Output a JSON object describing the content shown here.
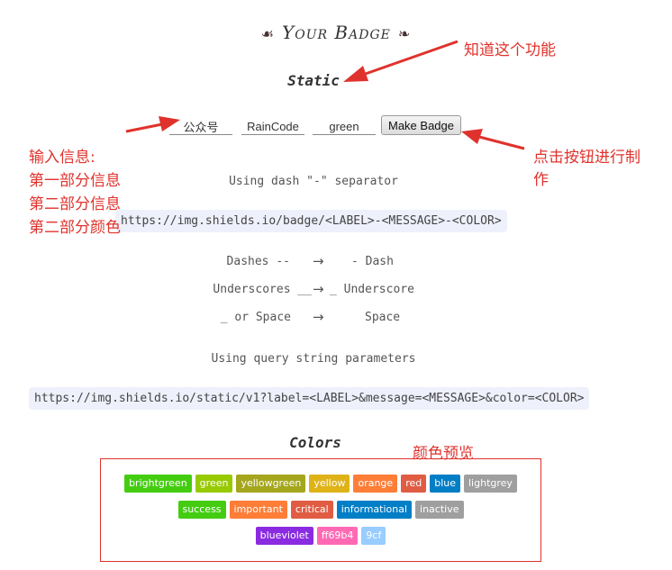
{
  "header": {
    "title": "Your Badge",
    "ornament_left": "☙",
    "ornament_right": "❧"
  },
  "static": {
    "heading": "Static",
    "label_value": "公众号",
    "message_value": "RainCode",
    "color_value": "green",
    "button_label": "Make Badge"
  },
  "dash": {
    "heading": "Using dash \"-\" separator",
    "url": "https://img.shields.io/badge/<LABEL>-<MESSAGE>-<COLOR>",
    "rules": [
      {
        "from": "Dashes --",
        "arrow": "→",
        "to": "- Dash"
      },
      {
        "from": "Underscores __",
        "arrow": "→",
        "to": "_ Underscore"
      },
      {
        "from": "_ or Space",
        "arrow": "→",
        "to": "Space"
      }
    ]
  },
  "query": {
    "heading": "Using query string parameters",
    "url": "https://img.shields.io/static/v1?label=<LABEL>&message=<MESSAGE>&color=<COLOR>"
  },
  "colors": {
    "heading": "Colors",
    "row1": [
      {
        "name": "brightgreen",
        "color": "#44cc11"
      },
      {
        "name": "green",
        "color": "#97ca00"
      },
      {
        "name": "yellowgreen",
        "color": "#a4a61d"
      },
      {
        "name": "yellow",
        "color": "#dfb317"
      },
      {
        "name": "orange",
        "color": "#fe7d37"
      },
      {
        "name": "red",
        "color": "#e05d44"
      },
      {
        "name": "blue",
        "color": "#007ec6"
      },
      {
        "name": "lightgrey",
        "color": "#9f9f9f"
      }
    ],
    "row2": [
      {
        "name": "success",
        "color": "#44cc11"
      },
      {
        "name": "important",
        "color": "#fe7d37"
      },
      {
        "name": "critical",
        "color": "#e05d44"
      },
      {
        "name": "informational",
        "color": "#007ec6"
      },
      {
        "name": "inactive",
        "color": "#9f9f9f"
      }
    ],
    "row3": [
      {
        "name": "blueviolet",
        "color": "#8a2be2"
      },
      {
        "name": "ff69b4",
        "color": "#ff69b4"
      },
      {
        "name": "9cf",
        "color": "#99ccff"
      }
    ]
  },
  "annotations": {
    "know_feature": "知道这个功能",
    "input_info": [
      "输入信息:",
      "第一部分信息",
      "第二部分信息",
      "第二部分颜色"
    ],
    "click_button": [
      "点击按钮进行制",
      "作"
    ],
    "color_preview": "颜色预览",
    "annotation_color": "#e0322c"
  }
}
